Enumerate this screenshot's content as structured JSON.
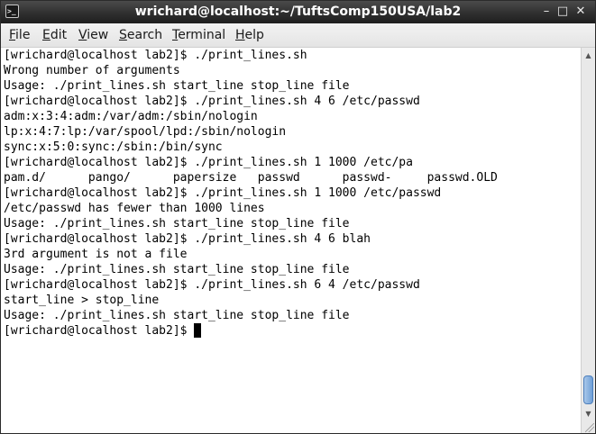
{
  "window": {
    "title": "wrichard@localhost:~/TuftsComp150USA/lab2",
    "icon": "terminal-icon",
    "controls": {
      "minimize": "–",
      "maximize": "□",
      "close": "✕"
    }
  },
  "menu": {
    "file": {
      "mnemonic": "F",
      "rest": "ile"
    },
    "edit": {
      "mnemonic": "E",
      "rest": "dit"
    },
    "view": {
      "mnemonic": "V",
      "rest": "iew"
    },
    "search": {
      "mnemonic": "S",
      "rest": "earch"
    },
    "terminal": {
      "mnemonic": "T",
      "rest": "erminal"
    },
    "help": {
      "mnemonic": "H",
      "rest": "elp"
    }
  },
  "terminal": {
    "lines": [
      "[wrichard@localhost lab2]$ ./print_lines.sh",
      "Wrong number of arguments",
      "Usage: ./print_lines.sh start_line stop_line file",
      "[wrichard@localhost lab2]$ ./print_lines.sh 4 6 /etc/passwd",
      "adm:x:3:4:adm:/var/adm:/sbin/nologin",
      "lp:x:4:7:lp:/var/spool/lpd:/sbin/nologin",
      "sync:x:5:0:sync:/sbin:/bin/sync",
      "[wrichard@localhost lab2]$ ./print_lines.sh 1 1000 /etc/pa",
      "pam.d/      pango/      papersize   passwd      passwd-     passwd.OLD",
      "[wrichard@localhost lab2]$ ./print_lines.sh 1 1000 /etc/passwd",
      "/etc/passwd has fewer than 1000 lines",
      "Usage: ./print_lines.sh start_line stop_line file",
      "[wrichard@localhost lab2]$ ./print_lines.sh 4 6 blah",
      "3rd argument is not a file",
      "Usage: ./print_lines.sh start_line stop_line file",
      "[wrichard@localhost lab2]$ ./print_lines.sh 6 4 /etc/passwd",
      "start_line > stop_line",
      "Usage: ./print_lines.sh start_line stop_line file",
      "[wrichard@localhost lab2]$ "
    ]
  },
  "scrollbar": {
    "up_icon": "▲",
    "down_icon": "▼",
    "position_fraction": 1.0
  }
}
